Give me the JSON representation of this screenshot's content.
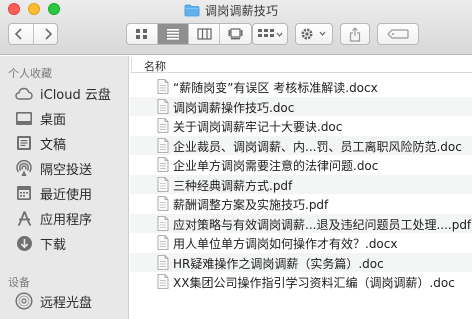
{
  "window": {
    "title": "调岗调薪技巧",
    "title_icon": "folder-icon"
  },
  "toolbar": {
    "back": "chevron-left-icon",
    "forward": "chevron-right-icon",
    "view_modes": [
      "icon-view-icon",
      "list-view-icon",
      "column-view-icon",
      "gallery-view-icon"
    ],
    "active_view": "list-view-icon",
    "group_by": "group-grid-icon",
    "action": "gear-icon",
    "share": "share-icon",
    "tags": "tag-icon"
  },
  "sidebar": {
    "favorites_header": "个人收藏",
    "favorites": [
      {
        "label": "iCloud 云盘",
        "icon": "cloud-icon"
      },
      {
        "label": "桌面",
        "icon": "desktop-icon"
      },
      {
        "label": "文稿",
        "icon": "documents-icon"
      },
      {
        "label": "隔空投送",
        "icon": "airdrop-icon"
      },
      {
        "label": "最近使用",
        "icon": "recents-icon"
      },
      {
        "label": "应用程序",
        "icon": "applications-icon"
      },
      {
        "label": "下载",
        "icon": "downloads-icon"
      }
    ],
    "devices_header": "设备",
    "devices": [
      {
        "label": "远程光盘",
        "icon": "optical-disc-icon"
      }
    ]
  },
  "file_list": {
    "column_name": "名称",
    "files": [
      {
        "name": "“薪随岗变”有误区 考核标准解读.docx",
        "type": "docx"
      },
      {
        "name": "调岗调薪操作技巧.doc",
        "type": "doc"
      },
      {
        "name": "关于调岗调薪牢记十大要诀.doc",
        "type": "doc"
      },
      {
        "name": "企业裁员、调岗调薪、内...罚、员工离职风险防范.doc",
        "type": "doc"
      },
      {
        "name": "企业单方调岗需要注意的法律问题.doc",
        "type": "doc"
      },
      {
        "name": "三种经典调薪方式.pdf",
        "type": "pdf"
      },
      {
        "name": "薪酬调整方案及实施技巧.pdf",
        "type": "pdf"
      },
      {
        "name": "应对策略与有效调岗调薪...退及违纪问题员工处理....pdf",
        "type": "pdf"
      },
      {
        "name": "用人单位单方调岗如何操作才有效？.docx",
        "type": "docx"
      },
      {
        "name": "HR疑难操作之调岗调薪（实务篇）.doc",
        "type": "doc"
      },
      {
        "name": "XX集团公司操作指引学习资料汇编（调岗调薪）.doc",
        "type": "doc"
      }
    ]
  }
}
